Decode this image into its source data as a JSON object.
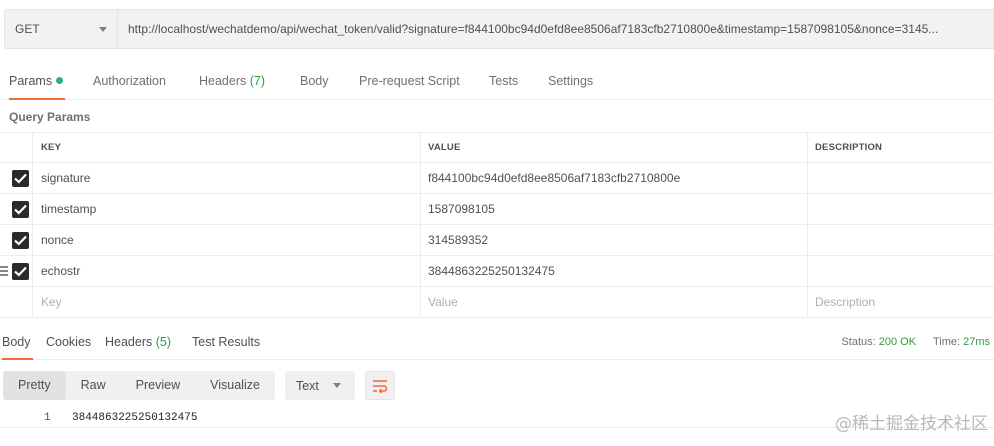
{
  "request": {
    "method": "GET",
    "url": "http://localhost/wechatdemo/api/wechat_token/valid?signature=f844100bc94d0efd8ee8506af7183cfb2710800e&timestamp=1587098105&nonce=3145..."
  },
  "tabs": {
    "params": "Params",
    "authorization": "Authorization",
    "headers": "Headers",
    "headers_count": "(7)",
    "body": "Body",
    "prerequest": "Pre-request Script",
    "tests": "Tests",
    "settings": "Settings"
  },
  "query_params": {
    "title": "Query Params",
    "columns": {
      "key": "KEY",
      "value": "VALUE",
      "description": "DESCRIPTION"
    },
    "rows": [
      {
        "key": "signature",
        "value": "f844100bc94d0efd8ee8506af7183cfb2710800e"
      },
      {
        "key": "timestamp",
        "value": "1587098105"
      },
      {
        "key": "nonce",
        "value": "314589352"
      },
      {
        "key": "echostr",
        "value": "3844863225250132475"
      }
    ],
    "placeholders": {
      "key": "Key",
      "value": "Value",
      "description": "Description"
    }
  },
  "response": {
    "tabs": {
      "body": "Body",
      "cookies": "Cookies",
      "headers": "Headers",
      "headers_count": "(5)",
      "test_results": "Test Results"
    },
    "status_label": "Status:",
    "status_value": "200 OK",
    "time_label": "Time:",
    "time_value": "27ms",
    "views": {
      "pretty": "Pretty",
      "raw": "Raw",
      "preview": "Preview",
      "visualize": "Visualize"
    },
    "format": "Text",
    "lines": [
      {
        "number": "1",
        "text": "3844863225250132475"
      }
    ]
  },
  "watermark": "@稀土掘金技术社区",
  "colors": {
    "accent": "#f26b3a",
    "success": "#2e9c3d",
    "dot": "#26b47f"
  }
}
